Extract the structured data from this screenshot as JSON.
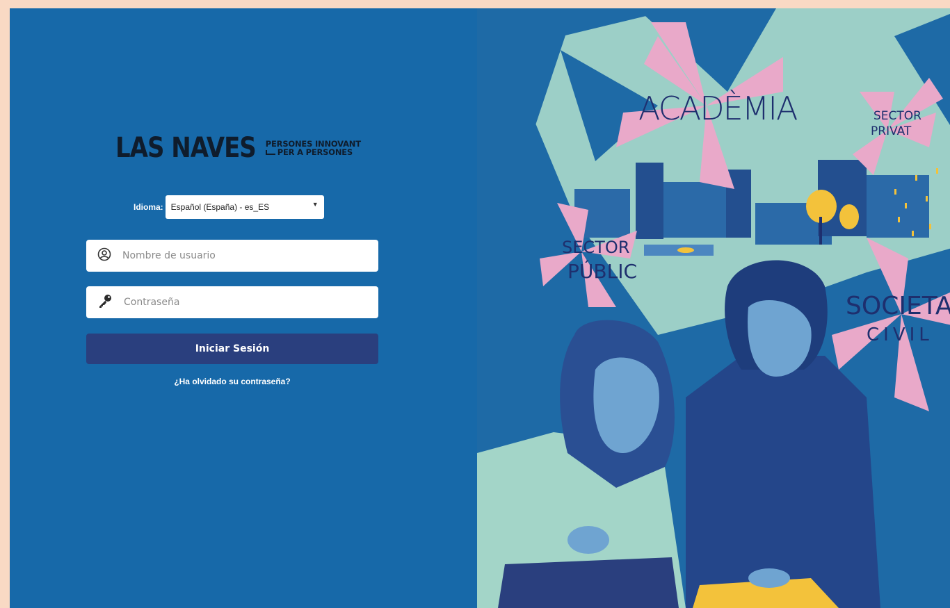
{
  "brand": {
    "name": "LAS NAVES",
    "tagline_1": "PERSONES INNOVANT",
    "tagline_2": "PER A PERSONES"
  },
  "language": {
    "label": "Idioma:",
    "selected": "Español (España) - es_ES"
  },
  "form": {
    "username_placeholder": "Nombre de usuario",
    "password_placeholder": "Contraseña",
    "submit_label": "Iniciar Sesión",
    "forgot_label": "¿Ha olvidado su contraseña?"
  },
  "illustration": {
    "labels": {
      "academia": "ACADÈMIA",
      "sector_privat_1": "SECTOR",
      "sector_privat_2": "PRIVAT",
      "sector_public_1": "SECTOR",
      "sector_public_2": "PÚBLIC",
      "societat_1": "SOCIETAT",
      "societat_2": "CIVIL"
    }
  },
  "colors": {
    "page_background": "#f9d9c4",
    "panel_blue": "#1769a9",
    "button_navy": "#2a3f7e",
    "pinwheel_pink": "#e9a9c9",
    "mint": "#a3d5c8",
    "yellow_accent": "#f3c23b"
  },
  "icons": {
    "username": "user-circle-icon",
    "password": "key-icon",
    "select_caret": "caret-down-icon"
  }
}
